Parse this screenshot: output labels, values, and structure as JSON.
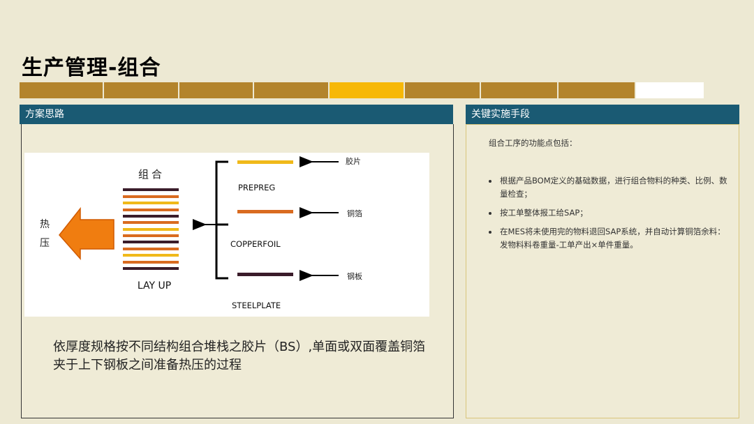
{
  "title": "生产管理-组合",
  "progress_colors": {
    "normal": "#b3842c",
    "active": "#f7b807",
    "blank": "#ffffff"
  },
  "left_panel": {
    "header": "方案思路"
  },
  "right_panel": {
    "header": "关键实施手段",
    "intro": "组合工序的功能点包括：",
    "bullets": [
      "根据产品BOM定义的基础数据，进行组合物料的种类、比例、数量检查；",
      "按工单整体报工给SAP；",
      "在MES将未使用完的物料退回SAP系统，并自动计算铜箔余料：发物料料卷重量-工单产出×单件重量。"
    ]
  },
  "diagram": {
    "stack_title": "组合",
    "hot_press": [
      "热",
      "压"
    ],
    "lay_up": "LAY UP",
    "layers": [
      {
        "name": "PREPREG",
        "cn": "胶片",
        "color": "#f0b91a"
      },
      {
        "name": "COPPERFOIL",
        "cn": "铜箔",
        "color": "#d96b20"
      },
      {
        "name": "STEELPLATE",
        "cn": "钢板",
        "color": "#3a1c2a"
      }
    ]
  },
  "caption": "依厚度规格按不同结构组合堆栈之胶片（BS）,单面或双面覆盖铜箔夹于上下钢板之间准备热压的过程"
}
